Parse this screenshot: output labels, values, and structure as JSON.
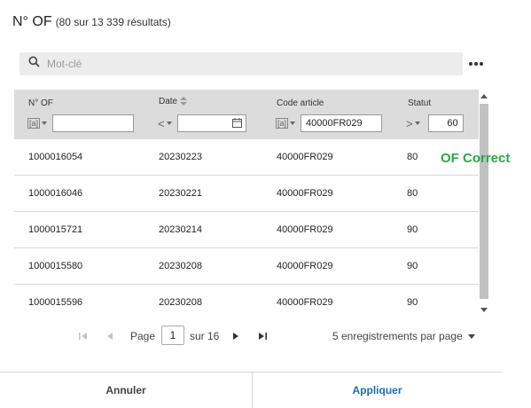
{
  "header": {
    "title": "N° OF",
    "count": "(80 sur 13 339 résultats)"
  },
  "search": {
    "placeholder": "Mot-clé",
    "icon": "search-icon"
  },
  "toolbar": {
    "more_icon": "more-horizontal-icon"
  },
  "grid": {
    "columns": [
      {
        "label": "N° OF",
        "operator": "[a]",
        "filter_value": ""
      },
      {
        "label": "Date",
        "operator": "<",
        "filter_value": "",
        "sortable": true
      },
      {
        "label": "Code article",
        "operator": "[a]",
        "filter_value": "40000FR029"
      },
      {
        "label": "Statut",
        "operator": ">",
        "filter_value": "60"
      }
    ],
    "rows": [
      [
        "1000016054",
        "20230223",
        "40000FR029",
        "80"
      ],
      [
        "1000016046",
        "20230221",
        "40000FR029",
        "80"
      ],
      [
        "1000015721",
        "20230214",
        "40000FR029",
        "90"
      ],
      [
        "1000015580",
        "20230208",
        "40000FR029",
        "90"
      ],
      [
        "1000015596",
        "20230208",
        "40000FR029",
        "90"
      ]
    ]
  },
  "annotation": {
    "text": "OF Correct",
    "color": "#2aa844"
  },
  "pager": {
    "page_label": "Page",
    "current_page": "1",
    "total_label": "sur 16",
    "per_page_label": "5 enregistrements par page"
  },
  "footer": {
    "cancel_label": "Annuler",
    "apply_label": "Appliquer"
  },
  "colors": {
    "accent": "#1a6fb3",
    "header_bg": "#dcdcdc",
    "search_bg": "#ececec"
  }
}
